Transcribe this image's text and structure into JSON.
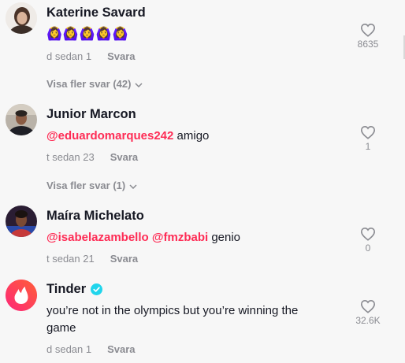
{
  "comments": [
    {
      "username": "Katerine Savard",
      "emoji_text": "🙆‍♀️🙆‍♀️🙆‍♀️🙆‍♀️🙆‍♀️",
      "time": "d sedan 1",
      "reply_label": "Svara",
      "likes": "8635",
      "view_more": "Visa fler svar (42)"
    },
    {
      "username": "Junior Marcon",
      "mentions": [
        "@eduardomarques242"
      ],
      "text_after": " amigo",
      "time": "t sedan 23",
      "reply_label": "Svara",
      "likes": "1",
      "view_more": "Visa fler svar (1)"
    },
    {
      "username": "Maíra Michelato",
      "mentions": [
        "@isabelazambello",
        "@fmzbabi"
      ],
      "text_after": " genio",
      "time": "t sedan 21",
      "reply_label": "Svara",
      "likes": "0"
    },
    {
      "username": "Tinder",
      "text": "you’re not in the olympics but you’re winning the game",
      "time": "d sedan 1",
      "reply_label": "Svara",
      "likes": "32.6K"
    }
  ],
  "colors": {
    "mention": "#fe2c55",
    "muted": "#8a8b91",
    "verified": "#20d5ec",
    "tinder_brand": "#fd267a"
  },
  "icons": [
    "heart-outline-icon",
    "chevron-down-icon",
    "verified-badge-icon",
    "tinder-flame-icon"
  ]
}
